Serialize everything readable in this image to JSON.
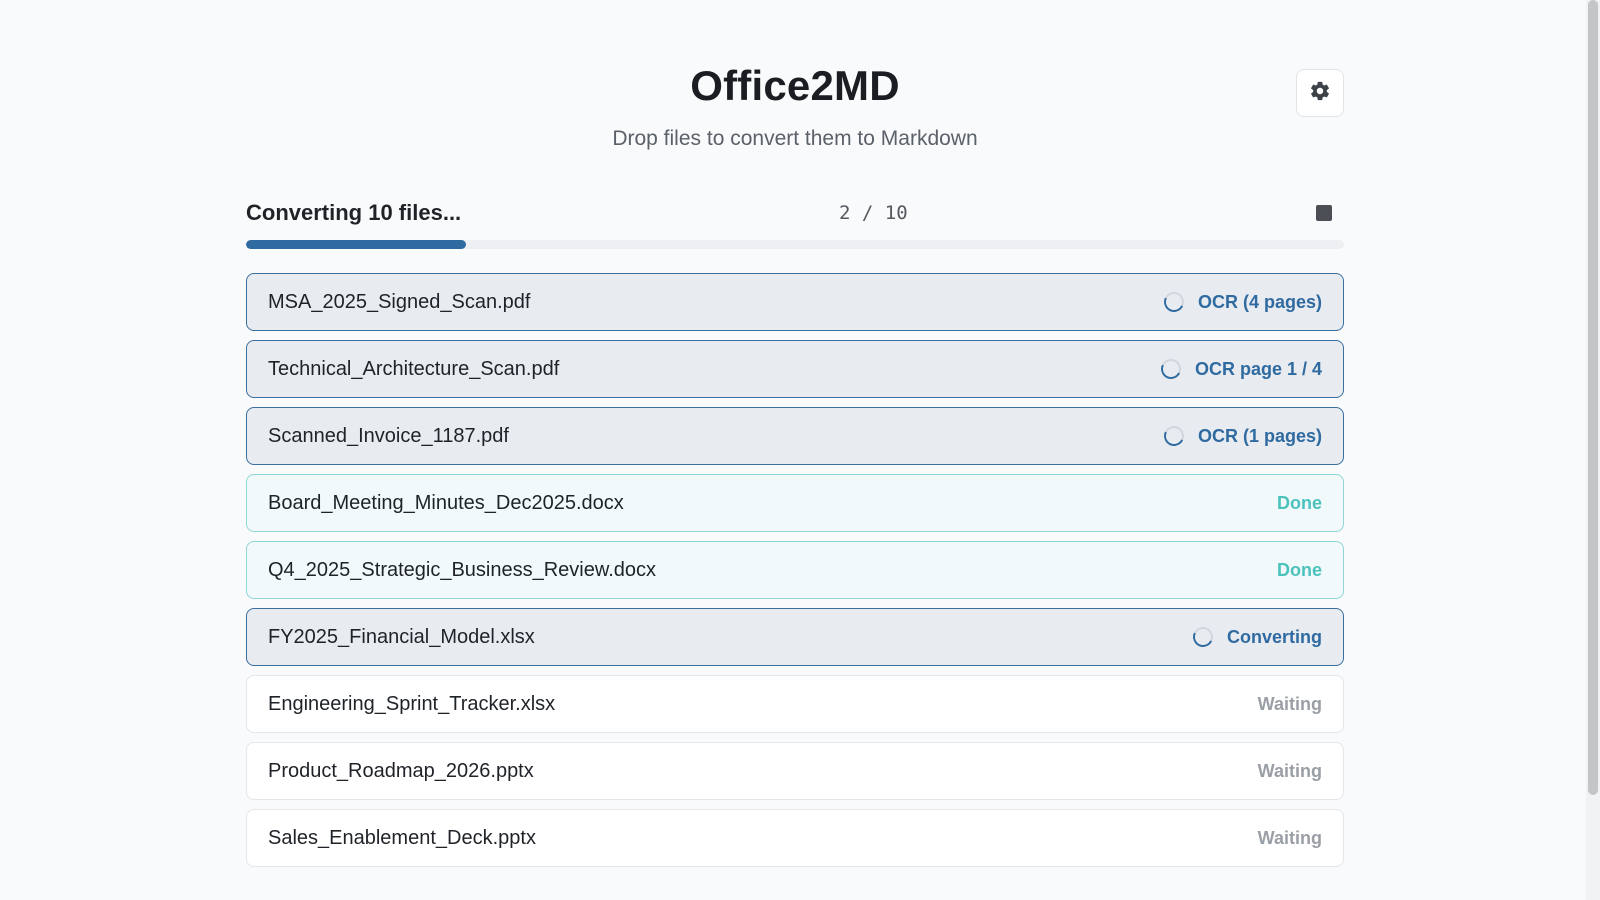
{
  "app": {
    "title": "Office2MD",
    "subtitle": "Drop files to convert them to Markdown",
    "settings_icon": "gear-icon"
  },
  "progress": {
    "title": "Converting 10 files...",
    "count_label": "2 / 10",
    "completed": 2,
    "total": 10,
    "stop_icon": "stop-icon"
  },
  "colors": {
    "accent": "#2f6aa0",
    "done": "#4cc2bd",
    "waiting": "#9a9fa6"
  },
  "files": [
    {
      "name": "MSA_2025_Signed_Scan.pdf",
      "status": "OCR (4 pages)",
      "state": "processing"
    },
    {
      "name": "Technical_Architecture_Scan.pdf",
      "status": "OCR page 1 / 4",
      "state": "processing"
    },
    {
      "name": "Scanned_Invoice_1187.pdf",
      "status": "OCR (1 pages)",
      "state": "processing"
    },
    {
      "name": "Board_Meeting_Minutes_Dec2025.docx",
      "status": "Done",
      "state": "done"
    },
    {
      "name": "Q4_2025_Strategic_Business_Review.docx",
      "status": "Done",
      "state": "done"
    },
    {
      "name": "FY2025_Financial_Model.xlsx",
      "status": "Converting",
      "state": "processing"
    },
    {
      "name": "Engineering_Sprint_Tracker.xlsx",
      "status": "Waiting",
      "state": "waiting"
    },
    {
      "name": "Product_Roadmap_2026.pptx",
      "status": "Waiting",
      "state": "waiting"
    },
    {
      "name": "Sales_Enablement_Deck.pptx",
      "status": "Waiting",
      "state": "waiting"
    }
  ]
}
